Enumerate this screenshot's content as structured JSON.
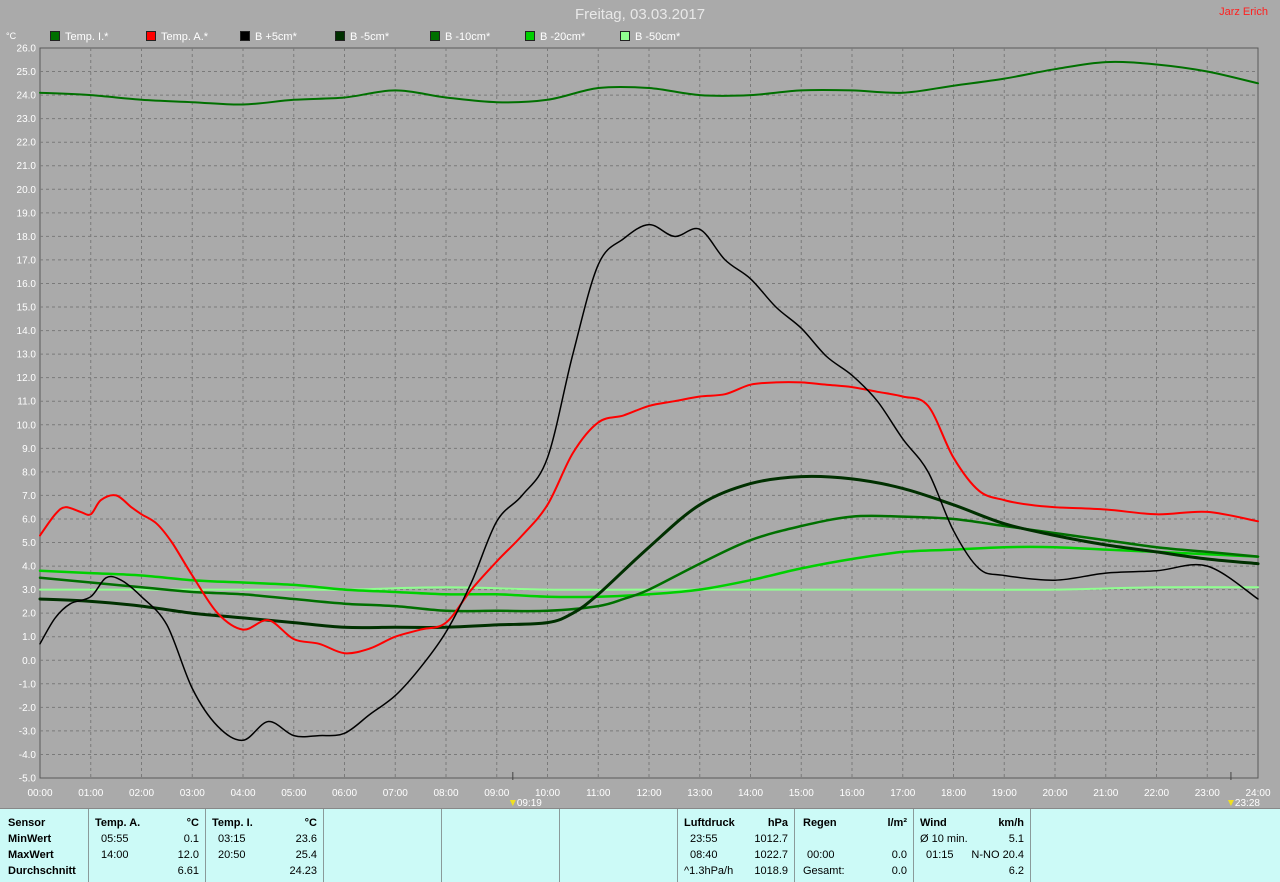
{
  "header": {
    "title": "Freitag, 03.03.2017",
    "author": "Jarz Erich"
  },
  "unit_label": "°C",
  "colors": {
    "background": "#aaaaaa",
    "grid": "#7a7a7a",
    "panel": "#ccfaf7"
  },
  "legend": [
    {
      "label": "Temp. I.*",
      "color": "#007000"
    },
    {
      "label": "Temp. A.*",
      "color": "#ff0000"
    },
    {
      "label": "B +5cm*",
      "color": "#000000"
    },
    {
      "label": "B -5cm*",
      "color": "#003000"
    },
    {
      "label": "B -10cm*",
      "color": "#007000"
    },
    {
      "label": "B -20cm*",
      "color": "#00d000"
    },
    {
      "label": "B -50cm*",
      "color": "#90ff90"
    }
  ],
  "markers": {
    "start": "09:19",
    "end": "23:28"
  },
  "chart_data": {
    "type": "line",
    "xlabel": "",
    "ylabel": "°C",
    "xlim": [
      0,
      24
    ],
    "ylim": [
      -5,
      26
    ],
    "x_ticks": [
      "00:00",
      "01:00",
      "02:00",
      "03:00",
      "04:00",
      "05:00",
      "06:00",
      "07:00",
      "08:00",
      "09:00",
      "10:00",
      "11:00",
      "12:00",
      "13:00",
      "14:00",
      "15:00",
      "16:00",
      "17:00",
      "18:00",
      "19:00",
      "20:00",
      "21:00",
      "22:00",
      "23:00",
      "24:00"
    ],
    "y_ticks": [
      "26.0",
      "25.0",
      "24.0",
      "23.0",
      "22.0",
      "21.0",
      "20.0",
      "19.0",
      "18.0",
      "17.0",
      "16.0",
      "15.0",
      "14.0",
      "13.0",
      "12.0",
      "11.0",
      "10.0",
      "9.0",
      "8.0",
      "7.0",
      "6.0",
      "5.0",
      "4.0",
      "3.0",
      "2.0",
      "1.0",
      "0.0",
      "-1.0",
      "-2.0",
      "-3.0",
      "-4.0",
      "-5.0"
    ],
    "grid": true,
    "series": [
      {
        "name": "Temp. I.*",
        "color": "#007000",
        "width": 2,
        "x": [
          0,
          1,
          2,
          3,
          4,
          5,
          6,
          7,
          8,
          9,
          10,
          11,
          12,
          13,
          14,
          15,
          16,
          17,
          18,
          19,
          20,
          21,
          22,
          23,
          24
        ],
        "y": [
          24.1,
          24.0,
          23.8,
          23.7,
          23.6,
          23.8,
          23.9,
          24.2,
          23.9,
          23.7,
          23.8,
          24.3,
          24.3,
          24.0,
          24.0,
          24.2,
          24.2,
          24.1,
          24.4,
          24.7,
          25.1,
          25.4,
          25.3,
          25.0,
          24.5
        ]
      },
      {
        "name": "Temp. A.*",
        "color": "#ff0000",
        "width": 2,
        "x": [
          0,
          0.3,
          0.5,
          0.8,
          1,
          1.2,
          1.5,
          1.8,
          2,
          2.3,
          2.6,
          3,
          3.5,
          4,
          4.5,
          5,
          5.5,
          6,
          6.5,
          7,
          7.5,
          8,
          8.5,
          9,
          9.5,
          10,
          10.5,
          11,
          11.5,
          12,
          12.5,
          13,
          13.5,
          14,
          14.5,
          15,
          15.5,
          16,
          16.5,
          17,
          17.5,
          18,
          18.5,
          19,
          19.5,
          20,
          21,
          22,
          23,
          24
        ],
        "y": [
          5.3,
          6.2,
          6.5,
          6.3,
          6.2,
          6.8,
          7.0,
          6.5,
          6.2,
          5.8,
          5.0,
          3.6,
          2.0,
          1.3,
          1.7,
          0.9,
          0.7,
          0.3,
          0.5,
          1.0,
          1.3,
          1.6,
          3.0,
          4.2,
          5.3,
          6.6,
          8.8,
          10.1,
          10.4,
          10.8,
          11.0,
          11.2,
          11.3,
          11.7,
          11.8,
          11.8,
          11.7,
          11.6,
          11.4,
          11.2,
          10.8,
          8.6,
          7.2,
          6.8,
          6.6,
          6.5,
          6.4,
          6.2,
          6.3,
          5.9
        ]
      },
      {
        "name": "B +5cm*",
        "color": "#000000",
        "width": 1.5,
        "x": [
          0,
          0.3,
          0.6,
          1,
          1.3,
          1.6,
          2,
          2.5,
          3,
          3.5,
          4,
          4.5,
          5,
          5.5,
          6,
          6.5,
          7,
          7.5,
          8,
          8.5,
          9,
          9.5,
          10,
          10.5,
          11,
          11.5,
          12,
          12.5,
          13,
          13.5,
          14,
          14.5,
          15,
          15.5,
          16,
          16.5,
          17,
          17.5,
          18,
          18.5,
          19,
          20,
          21,
          22,
          23,
          24
        ],
        "y": [
          0.7,
          1.8,
          2.4,
          2.7,
          3.5,
          3.4,
          2.7,
          1.5,
          -1.2,
          -2.8,
          -3.4,
          -2.6,
          -3.2,
          -3.2,
          -3.1,
          -2.3,
          -1.5,
          -0.3,
          1.2,
          3.3,
          5.9,
          7.0,
          8.6,
          13.0,
          16.8,
          17.9,
          18.5,
          18.0,
          18.3,
          17.0,
          16.2,
          15.0,
          14.1,
          12.9,
          12.1,
          11.0,
          9.4,
          8.0,
          5.5,
          3.9,
          3.6,
          3.4,
          3.7,
          3.8,
          4.0,
          2.6
        ]
      },
      {
        "name": "B -5cm*",
        "color": "#003000",
        "width": 3,
        "x": [
          0,
          1,
          2,
          3,
          4,
          5,
          6,
          7,
          8,
          9,
          10,
          10.5,
          11,
          12,
          13,
          14,
          15,
          16,
          17,
          18,
          19,
          20,
          21,
          22,
          23,
          24
        ],
        "y": [
          2.6,
          2.5,
          2.3,
          2.0,
          1.8,
          1.6,
          1.4,
          1.4,
          1.4,
          1.5,
          1.6,
          2.0,
          2.8,
          4.8,
          6.6,
          7.5,
          7.8,
          7.7,
          7.3,
          6.6,
          5.8,
          5.3,
          4.9,
          4.6,
          4.3,
          4.1
        ]
      },
      {
        "name": "B -10cm*",
        "color": "#007000",
        "width": 2.5,
        "x": [
          0,
          1,
          2,
          3,
          4,
          5,
          6,
          7,
          8,
          9,
          10,
          11,
          11.5,
          12,
          13,
          14,
          15,
          16,
          17,
          18,
          19,
          20,
          21,
          22,
          23,
          24
        ],
        "y": [
          3.5,
          3.3,
          3.1,
          2.9,
          2.8,
          2.6,
          2.4,
          2.3,
          2.1,
          2.1,
          2.1,
          2.3,
          2.6,
          3.0,
          4.1,
          5.1,
          5.7,
          6.1,
          6.1,
          6.0,
          5.7,
          5.4,
          5.1,
          4.8,
          4.6,
          4.4
        ]
      },
      {
        "name": "B -20cm*",
        "color": "#00d000",
        "width": 2.5,
        "x": [
          0,
          1,
          2,
          3,
          4,
          5,
          6,
          7,
          8,
          9,
          10,
          11,
          12,
          13,
          14,
          15,
          16,
          17,
          18,
          19,
          20,
          21,
          22,
          23,
          24
        ],
        "y": [
          3.8,
          3.7,
          3.6,
          3.4,
          3.3,
          3.2,
          3.0,
          2.9,
          2.8,
          2.8,
          2.7,
          2.7,
          2.8,
          3.0,
          3.4,
          3.9,
          4.3,
          4.6,
          4.7,
          4.8,
          4.8,
          4.7,
          4.6,
          4.5,
          4.4
        ]
      },
      {
        "name": "B -50cm*",
        "color": "#90ff90",
        "width": 2,
        "x": [
          0,
          1,
          2,
          4,
          6,
          8,
          10,
          12,
          14,
          16,
          18,
          20,
          22,
          24
        ],
        "y": [
          3.0,
          3.0,
          3.0,
          3.0,
          3.0,
          3.1,
          3.0,
          3.0,
          3.0,
          3.0,
          3.0,
          3.0,
          3.1,
          3.1
        ]
      }
    ]
  },
  "stats": {
    "sensor_header": "Sensor",
    "rows": [
      "MinWert",
      "MaxWert",
      "Durchschnitt"
    ],
    "temp_a": {
      "title": "Temp. A.",
      "unit": "°C",
      "min_time": "05:55",
      "min": "0.1",
      "max_time": "14:00",
      "max": "12.0",
      "avg": "6.61"
    },
    "temp_i": {
      "title": "Temp. I.",
      "unit": "°C",
      "min_time": "03:15",
      "min": "23.6",
      "max_time": "20:50",
      "max": "25.4",
      "avg": "24.23"
    },
    "pressure": {
      "title": "Luftdruck",
      "unit": "hPa",
      "min_time": "23:55",
      "min": "1012.7",
      "max_time": "08:40",
      "max": "1022.7",
      "trend": "^1.3hPa/h",
      "avg": "1018.9"
    },
    "rain": {
      "title": "Regen",
      "unit": "l/m²",
      "time": "00:00",
      "value": "0.0",
      "total_label": "Gesamt:",
      "total": "0.0"
    },
    "wind": {
      "title": "Wind",
      "unit": "km/h",
      "avg_label": "Ø 10 min.",
      "avg": "5.1",
      "max_time": "01:15",
      "max": "N-NO 20.4",
      "overall": "6.2"
    }
  }
}
